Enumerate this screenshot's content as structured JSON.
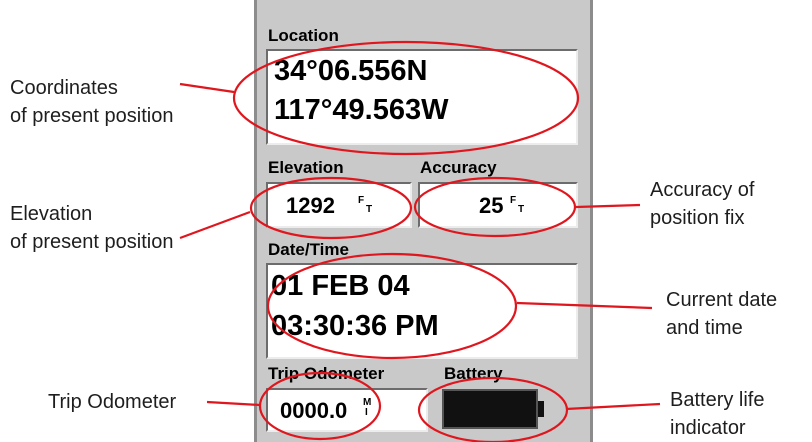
{
  "display": {
    "location": {
      "label": "Location",
      "latitude": "34°06.556N",
      "longitude": "117°49.563W"
    },
    "elevation": {
      "label": "Elevation",
      "value": "1292",
      "unit_top": "F",
      "unit_bottom": "T"
    },
    "accuracy": {
      "label": "Accuracy",
      "value": "25",
      "unit_top": "F",
      "unit_bottom": "T"
    },
    "datetime": {
      "label": "Date/Time",
      "date": "01 FEB 04",
      "time": "03:30:36 PM"
    },
    "odometer": {
      "label": "Trip Odometer",
      "value": "0000.0",
      "unit_top": "M",
      "unit_bottom": "I"
    },
    "battery": {
      "label": "Battery"
    }
  },
  "callouts": {
    "coordinates": [
      "Coordinates",
      "of present position"
    ],
    "elevation": [
      "Elevation",
      "of present position"
    ],
    "accuracy": [
      "Accuracy of",
      "position fix"
    ],
    "datetime": [
      "Current date",
      "and time"
    ],
    "odometer": [
      "Trip Odometer"
    ],
    "battery": [
      "Battery life",
      "indicator"
    ]
  },
  "colors": {
    "annotation": "#e0161e",
    "panel": "#c9c9c9"
  }
}
